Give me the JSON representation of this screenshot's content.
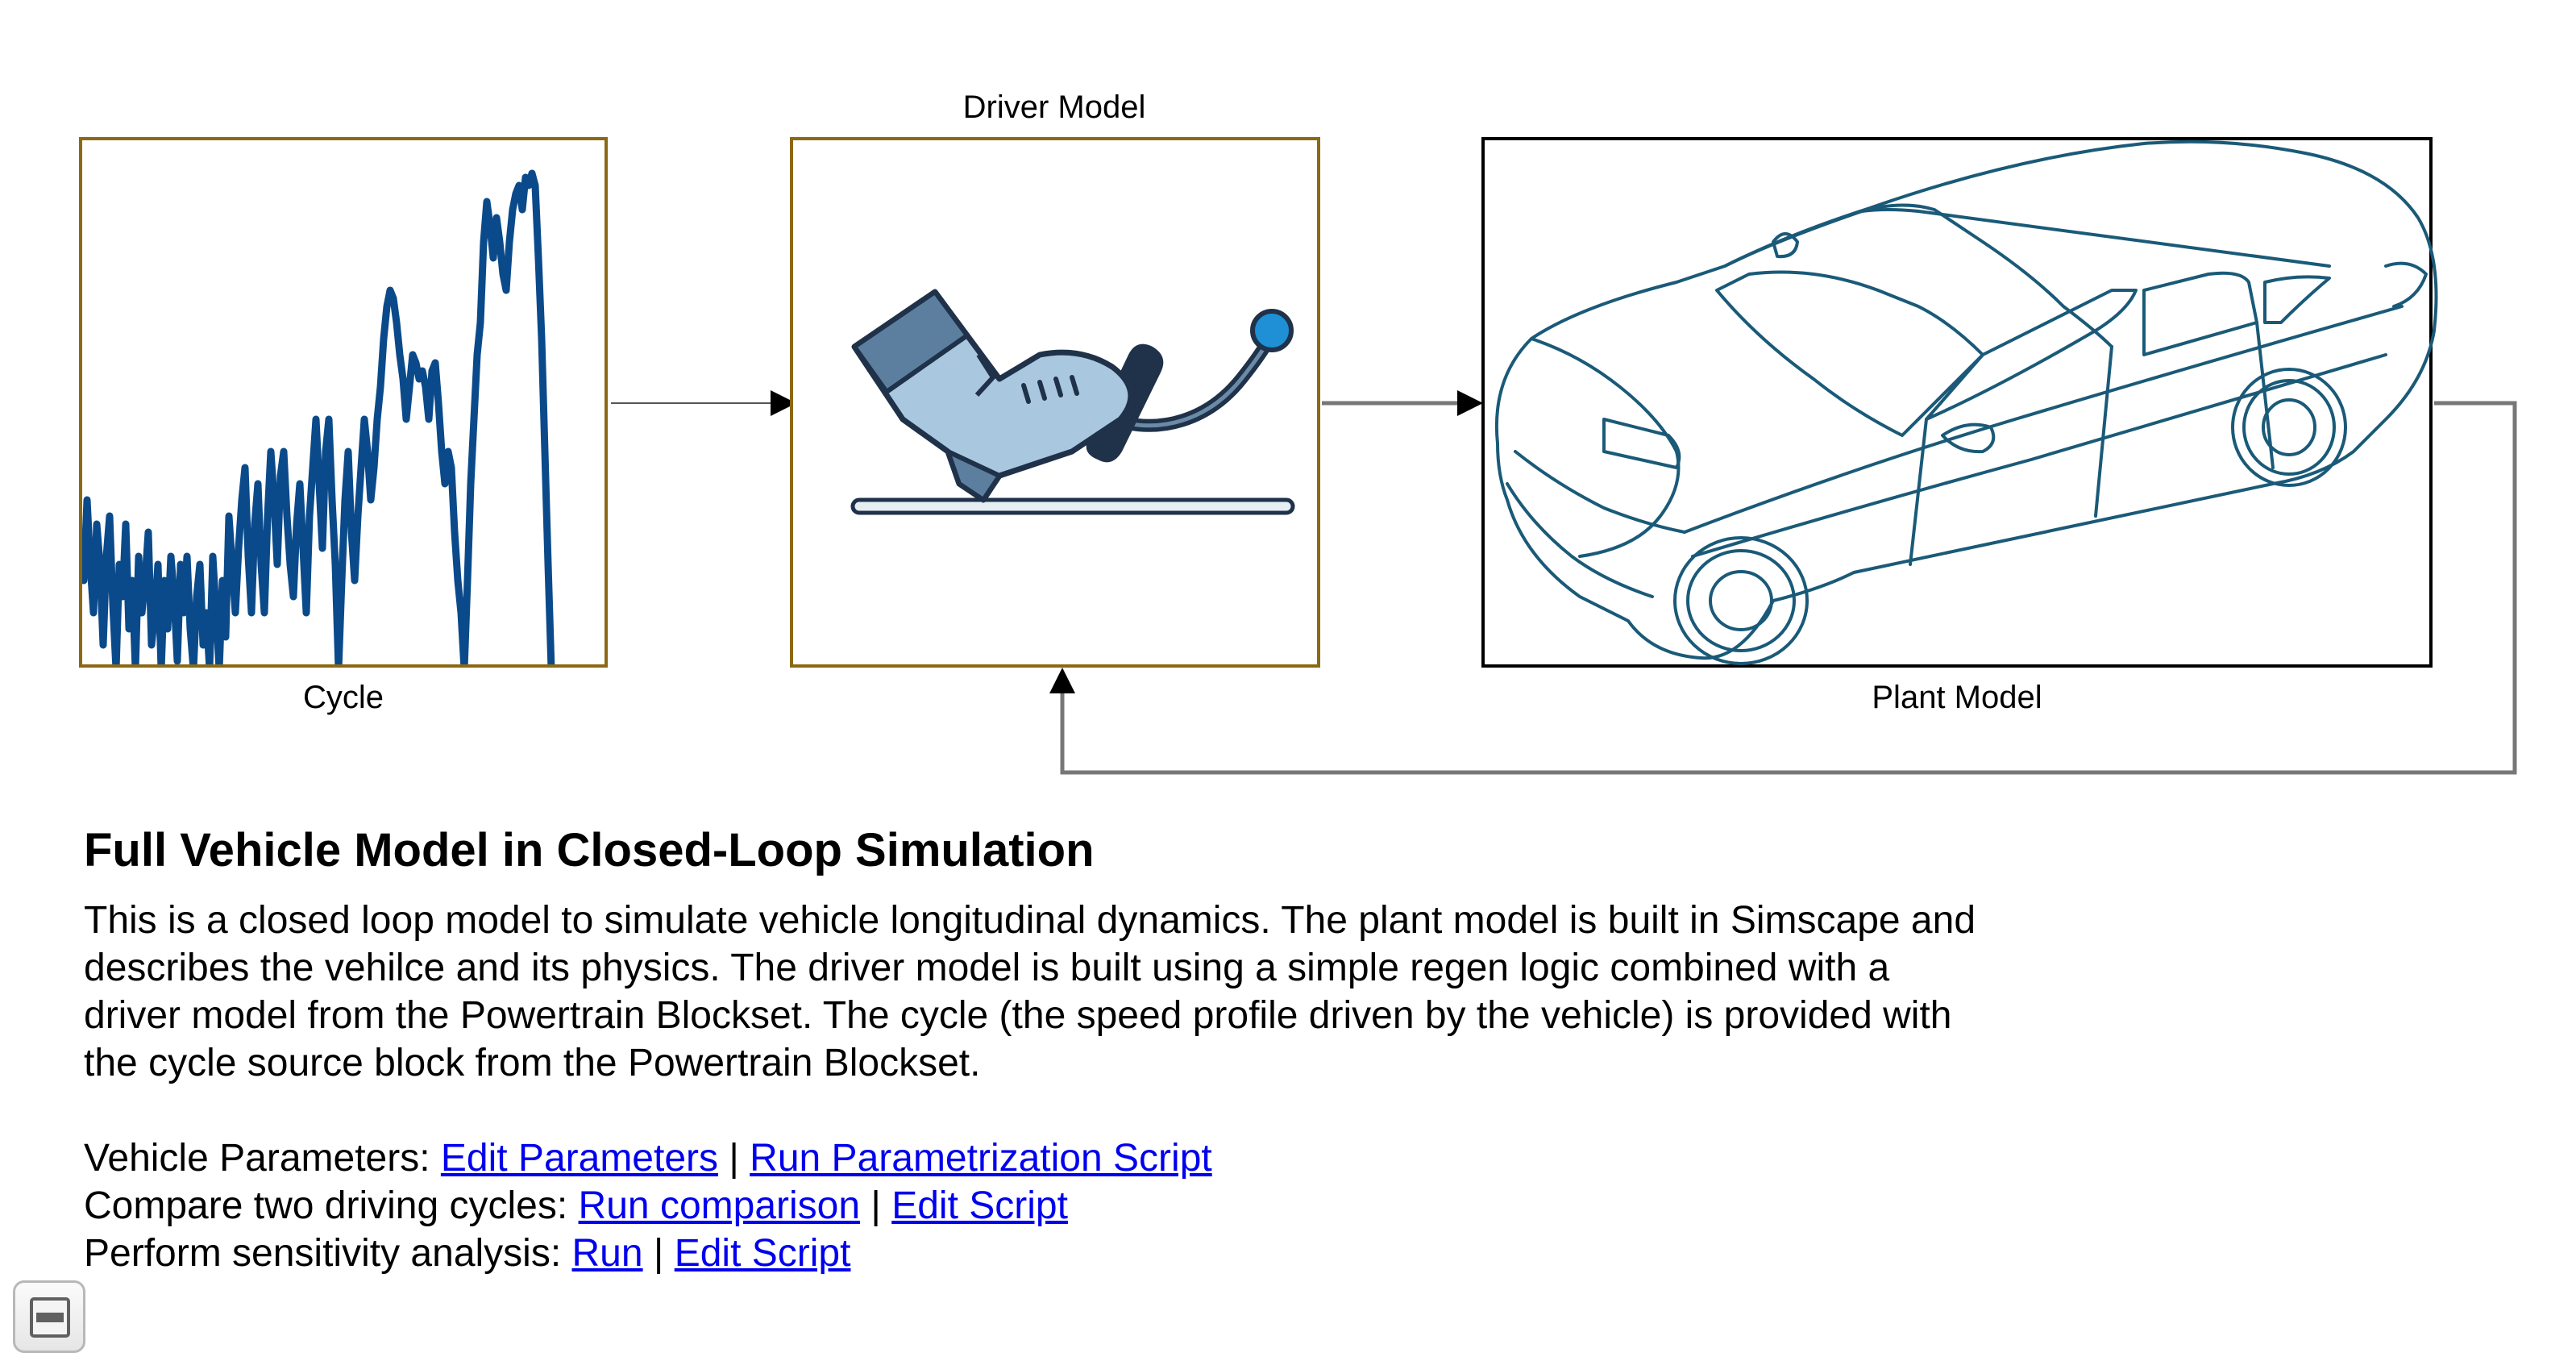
{
  "diagram": {
    "blocks": {
      "cycle": {
        "label": "Cycle"
      },
      "driver": {
        "label": "Driver Model"
      },
      "plant": {
        "label": "Plant Model"
      }
    },
    "colors": {
      "block_border_highlight": "#8b6914",
      "block_border_plain": "#000000",
      "cycle_trace": "#0b4a8a",
      "car_outline": "#1a5a78",
      "connector": "#777777",
      "pedal_boot": "#a9c8e0",
      "pedal_dark": "#1f3249",
      "pedal_knob": "#1f8fd6"
    },
    "icons": {
      "cycle": "speed-profile-icon",
      "driver": "pedal-boot-icon",
      "plant": "car-outline-icon"
    }
  },
  "description": {
    "title": "Full Vehicle Model in Closed-Loop Simulation",
    "body": "This is a closed loop model to simulate vehicle longitudinal dynamics. The plant model is built in Simscape and\ndescribes the vehilce and its physics. The driver model is built using a simple regen logic combined with a\ndriver model from the Powertrain Blockset. The cycle (the speed profile driven by the vehicle) is provided with\nthe cycle source block from the Powertrain Blockset."
  },
  "links": {
    "vehicle_parameters": {
      "prefix": "Vehicle Parameters: ",
      "link1": "Edit Parameters",
      "sep": " | ",
      "link2": "Run Parametrization Script"
    },
    "compare_cycles": {
      "prefix": "Compare two driving cycles: ",
      "link1": "Run comparison",
      "sep": " | ",
      "link2": "Edit Script"
    },
    "sensitivity": {
      "prefix": "Perform sensitivity analysis: ",
      "link1": "Run",
      "sep": " | ",
      "link2": "Edit Script"
    }
  },
  "collapse_button": {
    "icon": "collapse-icon"
  }
}
